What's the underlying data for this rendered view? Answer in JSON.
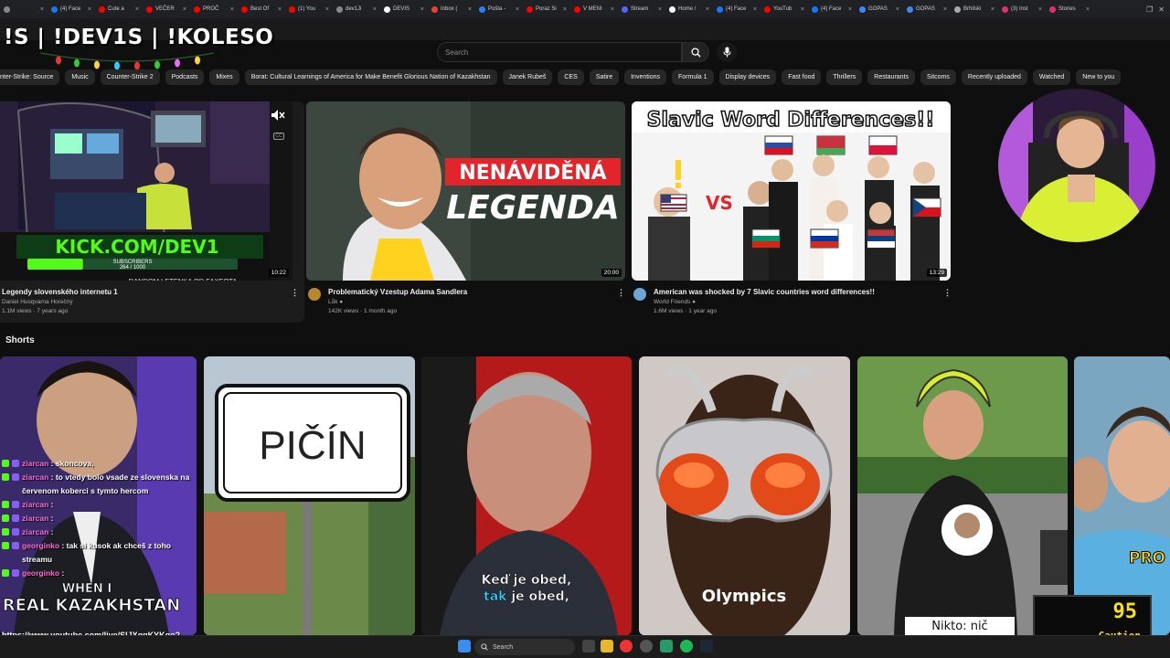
{
  "browser": {
    "tabs": [
      {
        "label": "",
        "color": "#888888"
      },
      {
        "label": "(4) Face",
        "color": "#1877f2"
      },
      {
        "label": "Cute a",
        "color": "#ff0000"
      },
      {
        "label": "VEČER",
        "color": "#ff0000"
      },
      {
        "label": "PROČ",
        "color": "#ff0000"
      },
      {
        "label": "Best Of",
        "color": "#ff0000"
      },
      {
        "label": "(1) You",
        "color": "#ff0000"
      },
      {
        "label": "dev1Ji",
        "color": "#888888"
      },
      {
        "label": "DEVIS",
        "color": "#ffffff"
      },
      {
        "label": "Inbox (",
        "color": "#ea4335"
      },
      {
        "label": "Pošta -",
        "color": "#2d7ff9"
      },
      {
        "label": "Poraz Si",
        "color": "#ff0000"
      },
      {
        "label": "V MENI",
        "color": "#ff0000"
      },
      {
        "label": "Stream",
        "color": "#5865f2"
      },
      {
        "label": "Home /",
        "color": "#ffffff"
      },
      {
        "label": "(4) Face",
        "color": "#1877f2"
      },
      {
        "label": "YouTub",
        "color": "#ff0000"
      },
      {
        "label": "(4) Face",
        "color": "#1877f2"
      },
      {
        "label": "GOPAS",
        "color": "#4285f4"
      },
      {
        "label": "GOPAS",
        "color": "#4285f4"
      },
      {
        "label": "Brhliski",
        "color": "#aaaaaa"
      },
      {
        "label": "(3) Inst",
        "color": "#e1306c"
      },
      {
        "label": "Stories",
        "color": "#e1306c"
      }
    ]
  },
  "overlay": {
    "title": "!S | !DEV1S | !KOLESO"
  },
  "header": {
    "search_placeholder": "Search",
    "search_icon": "search-icon",
    "mic_icon": "mic-icon"
  },
  "chips": [
    "nter-Strike: Source",
    "Music",
    "Counter-Strike 2",
    "Podcasts",
    "Mixes",
    "Borat: Cultural Learnings of America for Make Benefit Glorious Nation of Kazakhstan",
    "Janek Rubeš",
    "CES",
    "Satire",
    "Inventions",
    "Formula 1",
    "Display devices",
    "Fast food",
    "Thrillers",
    "Restaurants",
    "Sitcoms",
    "Recently uploaded",
    "Watched",
    "New to you"
  ],
  "videos": [
    {
      "title": "Legendy slovenského internetu 1",
      "channel": "Daniel Husqvarna Horečný",
      "meta": "1.1M views · 7 years ago",
      "duration": "10:22",
      "overlay_kick": "KICK.COM/DEV1",
      "subs_label": "SUBSCRIBERS",
      "subs_count": "264 / 1000",
      "subs_progress": 0.264,
      "ticker": "RANDOM LETENKA OD FAXEOTA"
    },
    {
      "title": "Problematický Vzestup Adama Sandlera",
      "channel": "Lůk",
      "meta": "142K views · 1 month ago",
      "duration": "20:00",
      "thumb_line1": "NENÁVIDĚNÁ",
      "thumb_line2": "LEGENDA"
    },
    {
      "title": "American was shocked by 7 Slavic countries word differences!!",
      "channel": "World Friends",
      "meta": "1.6M views · 1 year ago",
      "duration": "13:29",
      "thumb_title": "Slavic Word Differences!!",
      "thumb_vs": "VS"
    }
  ],
  "shorts": {
    "section_title": "Shorts",
    "items": [
      {
        "caption": "REAL KAZAKHSTAN",
        "caption_top": "WHEN I"
      },
      {
        "sign": "PIČÍN"
      },
      {
        "caption1a": "Keď",
        "caption1b": "je obed,",
        "caption2a": "tak",
        "caption2b": "je obed,"
      },
      {
        "caption": "Olympics"
      },
      {
        "caption": "Nikto: nič"
      },
      {
        "caption": "PRO"
      }
    ]
  },
  "chat": [
    {
      "user": "ziarcan",
      "text": ": skoncova,"
    },
    {
      "user": "ziarcan",
      "text": ": to vtedy bolo vsade ze slovenska na červenom koberci s tymto hercom"
    },
    {
      "user": "ziarcan",
      "text": ":"
    },
    {
      "user": "ziarcan",
      "text": ":"
    },
    {
      "user": "ziarcan",
      "text": ":"
    },
    {
      "user": "georginko",
      "text": ": tak si kusok ak chceš z toho streamu"
    },
    {
      "user": "georginko",
      "text": ":"
    }
  ],
  "chat_url": "https://www.youtube.com/live/SIJXqgKYKqo?si=Y1J_sioa0MOaWWof&t=10085",
  "caution": {
    "value": "95",
    "label": "Caution"
  },
  "taskbar": {
    "search_label": "Search"
  }
}
